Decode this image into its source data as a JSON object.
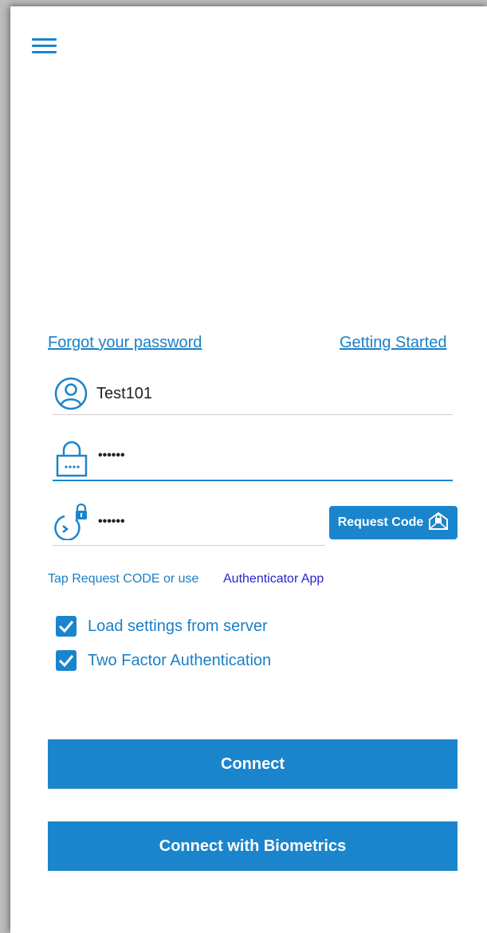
{
  "menu_icon": "hamburger-menu-icon",
  "links": {
    "forgot_password": "Forgot your password",
    "getting_started": "Getting Started"
  },
  "username": {
    "value": "Test101",
    "icon": "user-circle-icon"
  },
  "password": {
    "value": "••••••",
    "icon": "padlock-icon"
  },
  "code": {
    "value": "••••••",
    "icon": "code-lock-icon"
  },
  "request_code": {
    "label": "Request Code",
    "icon": "mail-lock-icon"
  },
  "hint": {
    "text": "Tap Request CODE or use",
    "link": "Authenticator App"
  },
  "checkboxes": [
    {
      "label": "Load settings from server",
      "checked": true
    },
    {
      "label": "Two Factor Authentication",
      "checked": true
    }
  ],
  "buttons": {
    "connect": "Connect",
    "connect_biometrics": "Connect with Biometrics"
  },
  "colors": {
    "accent": "#1a85cc",
    "link": "#1a80c8",
    "authenticator_link": "#2a1fd0"
  }
}
